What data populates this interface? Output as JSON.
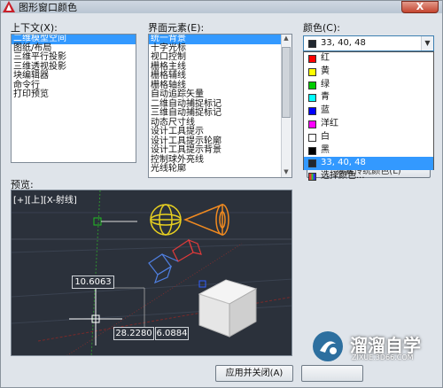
{
  "window": {
    "title": "图形窗口颜色",
    "close_label": "X"
  },
  "context": {
    "label": "上下文(X):",
    "items": [
      "二维模型空间",
      "图纸/布局",
      "三维平行投影",
      "三维透视投影",
      "块编辑器",
      "命令行",
      "打印预览"
    ],
    "selected_index": 0
  },
  "interface": {
    "label": "界面元素(E):",
    "items": [
      "统一背景",
      "十字光标",
      "视口控制",
      "栅格主线",
      "栅格辅线",
      "栅格轴线",
      "自动追踪矢量",
      "二维自动捕捉标记",
      "三维自动捕捉标记",
      "动态尺寸线",
      "设计工具提示",
      "设计工具提示轮廓",
      "设计工具提示背景",
      "控制球外亮线",
      "光线轮廓"
    ],
    "selected_index": 0
  },
  "color": {
    "label": "颜色(C):",
    "selected_label": "33, 40, 48",
    "selected_hex": "#212830",
    "options": [
      {
        "label": "红",
        "hex": "#ff0000"
      },
      {
        "label": "黄",
        "hex": "#ffff00"
      },
      {
        "label": "绿",
        "hex": "#00cc00"
      },
      {
        "label": "青",
        "hex": "#00ffff"
      },
      {
        "label": "蓝",
        "hex": "#0000ff"
      },
      {
        "label": "洋红",
        "hex": "#ff00ff"
      },
      {
        "label": "白",
        "hex": "#ffffff"
      },
      {
        "label": "黑",
        "hex": "#000000"
      },
      {
        "label": "33, 40, 48",
        "hex": "#212830"
      },
      {
        "label": "选择颜色...",
        "hex": "multi"
      }
    ],
    "selected_index": 8,
    "hidden_button_label": "恢复传统颜色(L)"
  },
  "preview": {
    "label": "预览:",
    "viewport_label": "[+][上][X-射线]",
    "dim1": "10.6063",
    "dim2": "28.2280",
    "dim3": "6.0884"
  },
  "buttons": {
    "apply_close": "应用并关闭(A)"
  },
  "watermark": {
    "name": "溜溜自学",
    "url": "ZIXUE.3D66.COM"
  }
}
